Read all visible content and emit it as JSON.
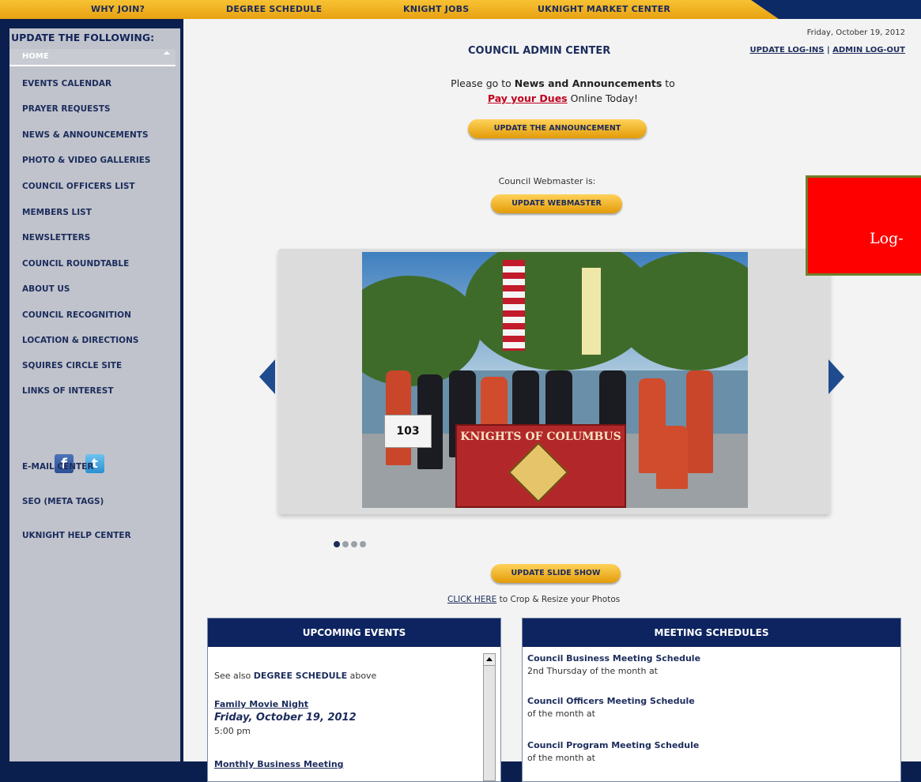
{
  "topnav": {
    "items": [
      {
        "label": "WHY JOIN?"
      },
      {
        "label": "DEGREE SCHEDULE"
      },
      {
        "label": "KNIGHT JOBS"
      },
      {
        "label": "UKNIGHT MARKET CENTER"
      }
    ]
  },
  "sidebar": {
    "title": "UPDATE THE FOLLOWING:",
    "home_label": "HOME",
    "items": [
      {
        "label": "EVENTS CALENDAR"
      },
      {
        "label": "PRAYER REQUESTS"
      },
      {
        "label": "NEWS & ANNOUNCEMENTS"
      },
      {
        "label": "PHOTO & VIDEO GALLERIES"
      },
      {
        "label": "COUNCIL OFFICERS LIST"
      },
      {
        "label": "MEMBERS LIST"
      },
      {
        "label": "NEWSLETTERS"
      },
      {
        "label": "COUNCIL ROUNDTABLE"
      },
      {
        "label": "ABOUT US"
      },
      {
        "label": "COUNCIL RECOGNITION"
      },
      {
        "label": "LOCATION & DIRECTIONS"
      },
      {
        "label": "SQUIRES CIRCLE SITE"
      },
      {
        "label": "LINKS OF INTEREST"
      }
    ],
    "facebook_glyph": "f",
    "twitter_glyph": "t",
    "extra": [
      {
        "label": "E-MAIL CENTER"
      },
      {
        "label": "SEO (META TAGS)"
      },
      {
        "label": "UKNIGHT HELP CENTER"
      }
    ]
  },
  "main": {
    "date": "Friday, October 19, 2012",
    "title": "COUNCIL ADMIN CENTER",
    "links": {
      "update_logins": "UPDATE LOG-INS",
      "separator": "|",
      "admin_logout": "ADMIN LOG-OUT"
    },
    "notice": {
      "pre": "Please go to ",
      "strong": "News and Announcements",
      "post": " to",
      "pay": "Pay your Dues",
      "pay_post": " Online Today!"
    },
    "update_announcement": "UPDATE THE ANNOUNCEMENT",
    "webmaster_label": "Council Webmaster is:",
    "update_webmaster": "UPDATE WEBMASTER",
    "slideshow": {
      "sign_number": "103",
      "banner_text": "KNIGHTS OF COLUMBUS",
      "dots": 4,
      "active_dot": 0
    },
    "update_slideshow": "UPDATE SLIDE SHOW",
    "crop": {
      "link": "CLICK HERE",
      "rest": " to Crop & Resize your Photos"
    }
  },
  "events": {
    "header": "UPCOMING EVENTS",
    "see_also_pre": "See also ",
    "see_also_strong": "DEGREE SCHEDULE",
    "see_also_post": " above",
    "event1_title": "Family Movie Night",
    "event1_date": "Friday, October 19, 2012",
    "event1_time": "5:00 pm",
    "event2_title": "Monthly Business Meeting"
  },
  "meetings": {
    "header": "MEETING SCHEDULES",
    "items": [
      {
        "title": "Council Business Meeting Schedule",
        "detail": "2nd Thursday of the month at"
      },
      {
        "title": "Council Officers Meeting Schedule",
        "detail": "of the month at"
      },
      {
        "title": "Council Program Meeting Schedule",
        "detail": "of the month at"
      }
    ]
  },
  "annotation": {
    "text": "Log-",
    "color": "#ff0000"
  }
}
